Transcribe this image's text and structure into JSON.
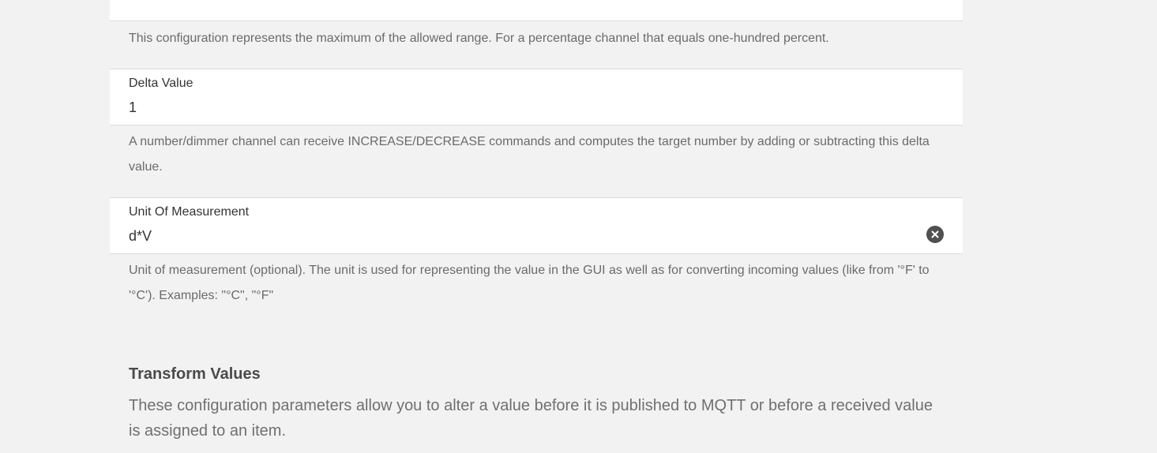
{
  "maximum": {
    "hint": "This configuration represents the maximum of the allowed range. For a percentage channel that equals one-hundred percent."
  },
  "delta": {
    "label": "Delta Value",
    "value": "1",
    "hint": "A number/dimmer channel can receive INCREASE/DECREASE commands and computes the target number by adding or subtracting this delta value."
  },
  "unit": {
    "label": "Unit Of Measurement",
    "value": "d*V",
    "clear_icon": "close-circle-icon",
    "hint": "Unit of measurement (optional). The unit is used for representing the value in the GUI as well as for converting incoming values (like from '°F' to '°C'). Examples: \"°C\", \"°F\""
  },
  "transform": {
    "title": "Transform Values",
    "description": "These configuration parameters allow you to alter a value before it is published to MQTT or before a received value is assigned to an item."
  },
  "colors": {
    "background": "#f2f2f2",
    "panel": "#ffffff",
    "hint_text": "#6b6b6b",
    "icon": "#505050"
  }
}
